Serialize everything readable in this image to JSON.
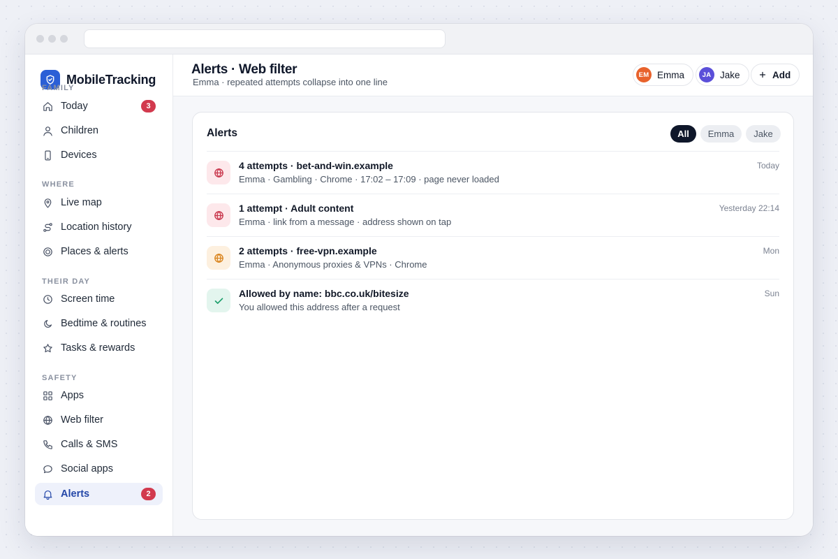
{
  "app": {
    "name": "MobileTracking",
    "colors": {
      "brand": "#2b5fd6",
      "danger": "#d23a4e",
      "warning": "#e08a1e",
      "success": "#1a9e6a"
    }
  },
  "sidebar": {
    "sections": [
      {
        "title": "FAMILY",
        "items": [
          {
            "label": "Today",
            "icon": "home-icon",
            "badge": "3"
          },
          {
            "label": "Children",
            "icon": "person-icon"
          },
          {
            "label": "Devices",
            "icon": "phone-icon"
          }
        ]
      },
      {
        "title": "WHERE",
        "items": [
          {
            "label": "Live map",
            "icon": "map-pin-icon"
          },
          {
            "label": "Location history",
            "icon": "route-icon"
          },
          {
            "label": "Places & alerts",
            "icon": "target-icon"
          }
        ]
      },
      {
        "title": "THEIR DAY",
        "items": [
          {
            "label": "Screen time",
            "icon": "clock-icon"
          },
          {
            "label": "Bedtime & routines",
            "icon": "moon-icon"
          },
          {
            "label": "Tasks & rewards",
            "icon": "star-icon"
          }
        ]
      },
      {
        "title": "SAFETY",
        "items": [
          {
            "label": "Apps",
            "icon": "grid-icon"
          },
          {
            "label": "Web filter",
            "icon": "globe-icon"
          },
          {
            "label": "Calls & SMS",
            "icon": "phone-call-icon"
          },
          {
            "label": "Social apps",
            "icon": "chat-bubble-icon"
          },
          {
            "label": "Alerts",
            "icon": "bell-icon",
            "badge": "2",
            "active": true
          }
        ]
      }
    ]
  },
  "header": {
    "title": "Alerts · Web filter",
    "subtitle": "Emma · repeated attempts collapse into one line",
    "children": [
      {
        "initials": "EM",
        "name": "Emma",
        "color": "#e8622c"
      },
      {
        "initials": "JA",
        "name": "Jake",
        "color": "#5b4fd9"
      }
    ],
    "add_label": "Add"
  },
  "card": {
    "title": "Alerts",
    "filters": [
      {
        "label": "All",
        "active": true
      },
      {
        "label": "Emma"
      },
      {
        "label": "Jake"
      }
    ],
    "alerts": [
      {
        "title": "4 attempts · bet-and-win.example",
        "subtitle": "Emma · Gambling · Chrome · 17:02 – 17:09 · page never loaded",
        "time": "Today",
        "icon": "globe-icon",
        "severity": "danger"
      },
      {
        "title": "1 attempt · Adult content",
        "subtitle": "Emma · link from a message · address shown on tap",
        "time": "Yesterday 22:14",
        "icon": "globe-icon",
        "severity": "danger"
      },
      {
        "title": "2 attempts · free-vpn.example",
        "subtitle": "Emma · Anonymous proxies & VPNs · Chrome",
        "time": "Mon",
        "icon": "globe-icon",
        "severity": "warning"
      },
      {
        "title": "Allowed by name: bbc.co.uk/bitesize",
        "subtitle": "You allowed this address after a request",
        "time": "Sun",
        "icon": "check-icon",
        "severity": "success"
      }
    ]
  }
}
